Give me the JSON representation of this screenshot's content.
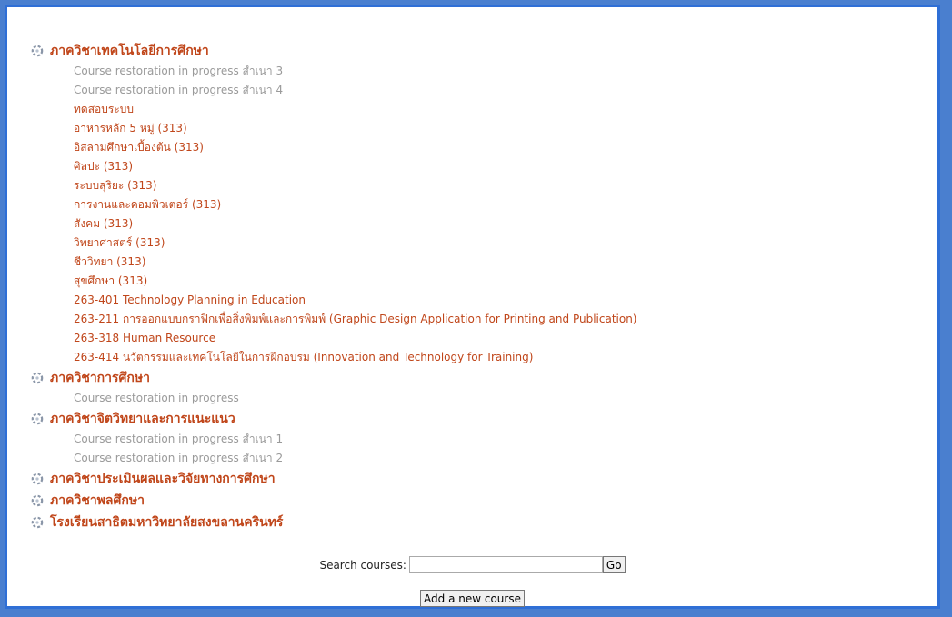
{
  "categories": [
    {
      "title": "ภาควิชาเทคโนโลยีการศึกษา",
      "courses": [
        {
          "label": "Course restoration in progress สำเนา 3",
          "dim": true
        },
        {
          "label": "Course restoration in progress สำเนา 4",
          "dim": true
        },
        {
          "label": "ทดสอบระบบ",
          "dim": false
        },
        {
          "label": "อาหารหลัก 5 หมู่ (313)",
          "dim": false
        },
        {
          "label": "อิสลามศึกษาเบื้องต้น (313)",
          "dim": false
        },
        {
          "label": "ศิลปะ (313)",
          "dim": false
        },
        {
          "label": "ระบบสุริยะ (313)",
          "dim": false
        },
        {
          "label": "การงานและคอมพิวเตอร์ (313)",
          "dim": false
        },
        {
          "label": "สังคม (313)",
          "dim": false
        },
        {
          "label": "วิทยาศาสตร์ (313)",
          "dim": false
        },
        {
          "label": "ชีววิทยา (313)",
          "dim": false
        },
        {
          "label": "สุขศึกษา (313)",
          "dim": false
        },
        {
          "label": "263-401 Technology Planning in Education",
          "dim": false
        },
        {
          "label": "263-211 การออกแบบกราฟิกเพื่อสิ่งพิมพ์และการพิมพ์ (Graphic Design Application for Printing and Publication)",
          "dim": false
        },
        {
          "label": "263-318 Human Resource",
          "dim": false
        },
        {
          "label": "263-414 นวัตกรรมและเทคโนโลยีในการฝึกอบรม (Innovation and Technology for Training)",
          "dim": false
        }
      ]
    },
    {
      "title": "ภาควิชาการศึกษา",
      "courses": [
        {
          "label": "Course restoration in progress",
          "dim": true
        }
      ]
    },
    {
      "title": "ภาควิชาจิตวิทยาและการแนะแนว",
      "courses": [
        {
          "label": "Course restoration in progress สำเนา 1",
          "dim": true
        },
        {
          "label": "Course restoration in progress สำเนา 2",
          "dim": true
        }
      ]
    },
    {
      "title": "ภาควิชาประเมินผลและวิจัยทางการศึกษา",
      "courses": []
    },
    {
      "title": "ภาควิชาพลศึกษา",
      "courses": []
    },
    {
      "title": "โรงเรียนสาธิตมหาวิทยาลัยสงขลานครินทร์",
      "courses": []
    }
  ],
  "search": {
    "label": "Search courses:",
    "value": "",
    "go_label": "Go"
  },
  "add_course_label": "Add a new course",
  "colors": {
    "link": "#c0461a",
    "dimmed": "#9a9a9a",
    "frame": "#2f6fd6"
  }
}
